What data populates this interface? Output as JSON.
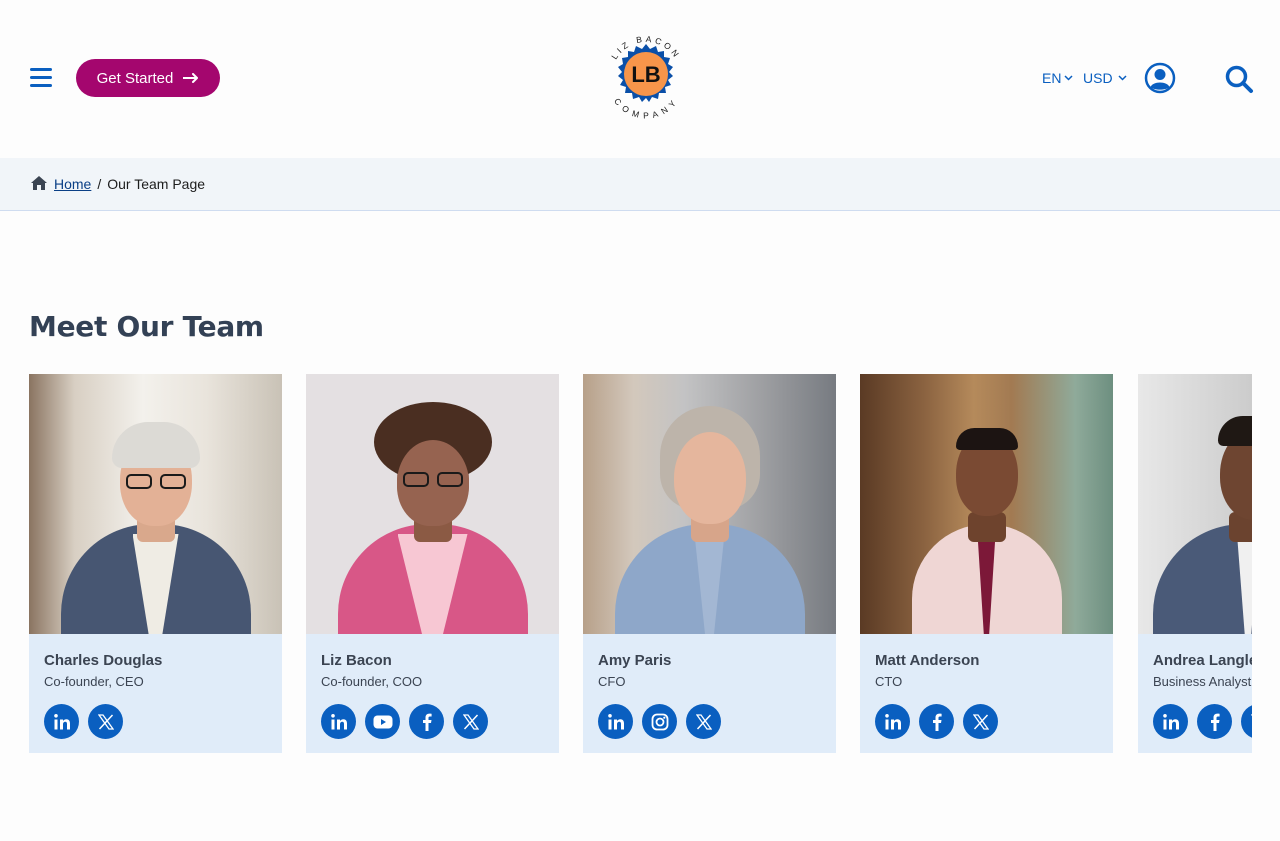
{
  "header": {
    "get_started_label": "Get Started",
    "logo": {
      "top_text": "LIZ BACON",
      "bottom_text": "COMPANY",
      "monogram": "LB"
    },
    "language": "EN",
    "currency": "USD",
    "icons": {
      "menu": "hamburger-menu-icon",
      "user": "user-account-icon",
      "search": "search-icon",
      "arrow": "arrow-right-icon"
    }
  },
  "breadcrumb": {
    "home_label": "Home",
    "separator": "/",
    "current_label": "Our Team Page"
  },
  "section": {
    "title": "Meet Our Team"
  },
  "team": [
    {
      "name": "Charles Douglas",
      "role": "Co-founder, CEO",
      "socials": [
        "linkedin",
        "x"
      ]
    },
    {
      "name": "Liz Bacon",
      "role": "Co-founder, COO",
      "socials": [
        "linkedin",
        "youtube",
        "facebook",
        "x"
      ]
    },
    {
      "name": "Amy Paris",
      "role": "CFO",
      "socials": [
        "linkedin",
        "instagram",
        "x"
      ]
    },
    {
      "name": "Matt Anderson",
      "role": "CTO",
      "socials": [
        "linkedin",
        "facebook",
        "x"
      ]
    },
    {
      "name": "Andrea Langley",
      "role": "Business Analyst",
      "socials": [
        "linkedin",
        "facebook",
        "x"
      ]
    }
  ],
  "colors": {
    "primary": "#0a5fc0",
    "cta": "#a4066e",
    "logo_orange": "#f7954a",
    "logo_blue": "#0a4fa8",
    "card_bg": "#e0ecf9",
    "heading": "#334155"
  }
}
